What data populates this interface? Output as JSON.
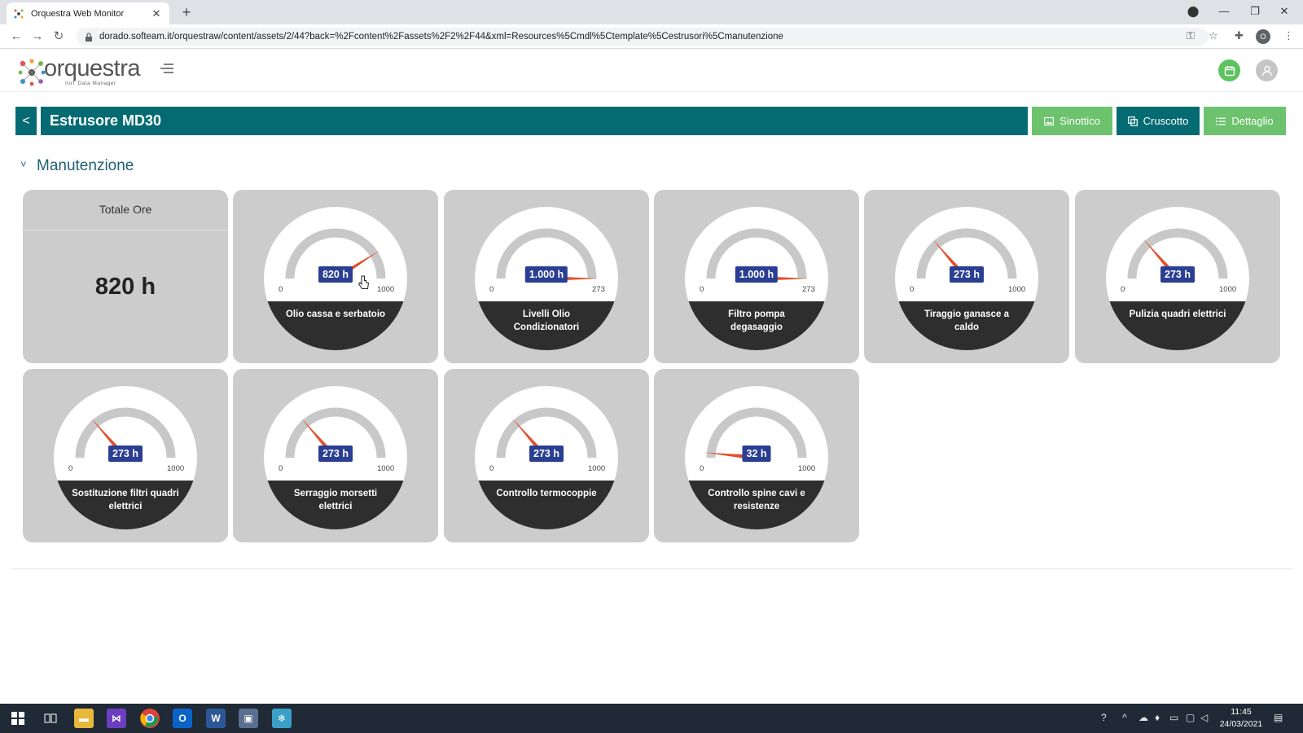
{
  "browser": {
    "tab_title": "Orquestra Web Monitor",
    "new_tab": "+",
    "url": "dorado.softeam.it/orquestraw/content/assets/2/44?back=%2Fcontent%2Fassets%2F2%2F44&xml=Resources%5Cmdl%5Ctemplate%5Cestrusori%5Cmanutenzione"
  },
  "app": {
    "brand": "orquestra",
    "brand_sub": "IIoT Data Manager",
    "accent_teal": "#056b73",
    "accent_green": "#6dc36d"
  },
  "header": {
    "title": "Estrusore MD30",
    "back": "<",
    "buttons": {
      "sinottico": "Sinottico",
      "cruscotto": "Cruscotto",
      "dettaglio": "Dettaglio"
    }
  },
  "section": {
    "toggle": "˅",
    "title": "Manutenzione"
  },
  "total": {
    "title": "Totale Ore",
    "value": "820 h"
  },
  "gauges": [
    {
      "label": "Olio cassa e serbatoio",
      "value_text": "820 h",
      "value": 820,
      "min": 0,
      "max": 1000,
      "min_text": "0",
      "max_text": "1000"
    },
    {
      "label": "Livelli Olio Condizionatori",
      "value_text": "1.000 h",
      "value": 1000,
      "min": 0,
      "max": 273,
      "min_text": "0",
      "max_text": "273"
    },
    {
      "label": "Filtro pompa degasaggio",
      "value_text": "1.000 h",
      "value": 1000,
      "min": 0,
      "max": 273,
      "min_text": "0",
      "max_text": "273"
    },
    {
      "label": "Tiraggio ganasce a caldo",
      "value_text": "273 h",
      "value": 273,
      "min": 0,
      "max": 1000,
      "min_text": "0",
      "max_text": "1000"
    },
    {
      "label": "Pulizia quadri elettrici",
      "value_text": "273 h",
      "value": 273,
      "min": 0,
      "max": 1000,
      "min_text": "0",
      "max_text": "1000"
    },
    {
      "label": "Sostituzione filtri quadri elettrici",
      "value_text": "273 h",
      "value": 273,
      "min": 0,
      "max": 1000,
      "min_text": "0",
      "max_text": "1000"
    },
    {
      "label": "Serraggio morsetti elettrici",
      "value_text": "273 h",
      "value": 273,
      "min": 0,
      "max": 1000,
      "min_text": "0",
      "max_text": "1000"
    },
    {
      "label": "Controllo termocoppie",
      "value_text": "273 h",
      "value": 273,
      "min": 0,
      "max": 1000,
      "min_text": "0",
      "max_text": "1000"
    },
    {
      "label": "Controllo spine cavi e resistenze",
      "value_text": "32 h",
      "value": 32,
      "min": 0,
      "max": 1000,
      "min_text": "0",
      "max_text": "1000"
    }
  ],
  "taskbar": {
    "time": "11:45",
    "date": "24/03/2021",
    "icons": [
      "windows-start-icon",
      "task-view-icon",
      "file-explorer-icon",
      "visual-studio-icon",
      "chrome-icon",
      "outlook-icon",
      "word-icon",
      "remote-desktop-icon",
      "app-icon"
    ]
  }
}
